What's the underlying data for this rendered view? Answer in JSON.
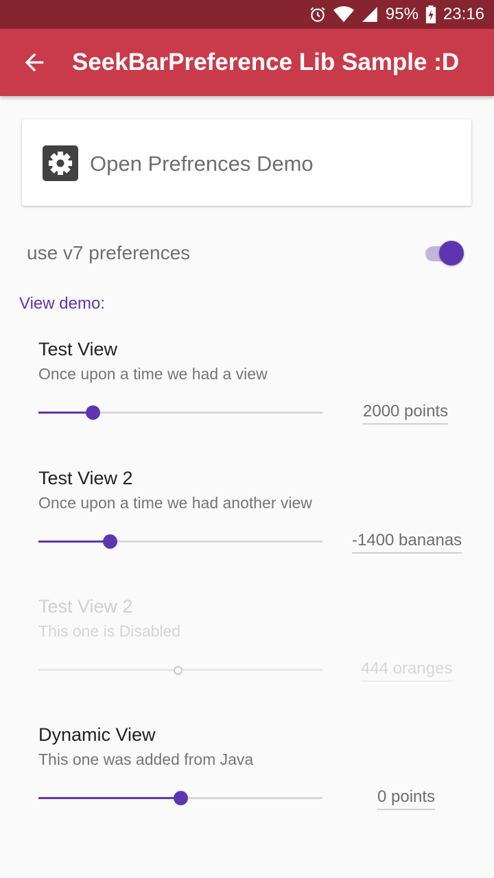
{
  "status_bar": {
    "battery": "95%",
    "time": "23:16",
    "icons": [
      "alarm-icon",
      "wifi-icon",
      "signal-icon",
      "battery-charging-icon"
    ]
  },
  "app_bar": {
    "title": "SeekBarPreference Lib Sample :D",
    "back_icon": "arrow-back-icon"
  },
  "demo_card": {
    "label": "Open Prefrences Demo",
    "icon": "settings-gear-icon"
  },
  "toggle": {
    "label": "use v7 preferences",
    "checked": true
  },
  "section": {
    "title": "View demo:"
  },
  "prefs": [
    {
      "title": "Test View",
      "summary": "Once upon a time we had a view",
      "value_text": "2000 points",
      "progress_fraction": 0.19,
      "enabled": true
    },
    {
      "title": "Test View 2",
      "summary": "Once upon a time we had another view",
      "value_text": "-1400 bananas",
      "progress_fraction": 0.25,
      "enabled": true
    },
    {
      "title": "Test View 2",
      "summary": "This one is Disabled",
      "value_text": "444 oranges",
      "progress_fraction": 0.49,
      "enabled": false
    },
    {
      "title": "Dynamic View",
      "summary": "This one was added from Java",
      "value_text": "0 points",
      "progress_fraction": 0.5,
      "enabled": true
    }
  ],
  "colors": {
    "status_bar": "#86252f",
    "app_bar": "#c93b4a",
    "accent": "#5e35b1"
  }
}
